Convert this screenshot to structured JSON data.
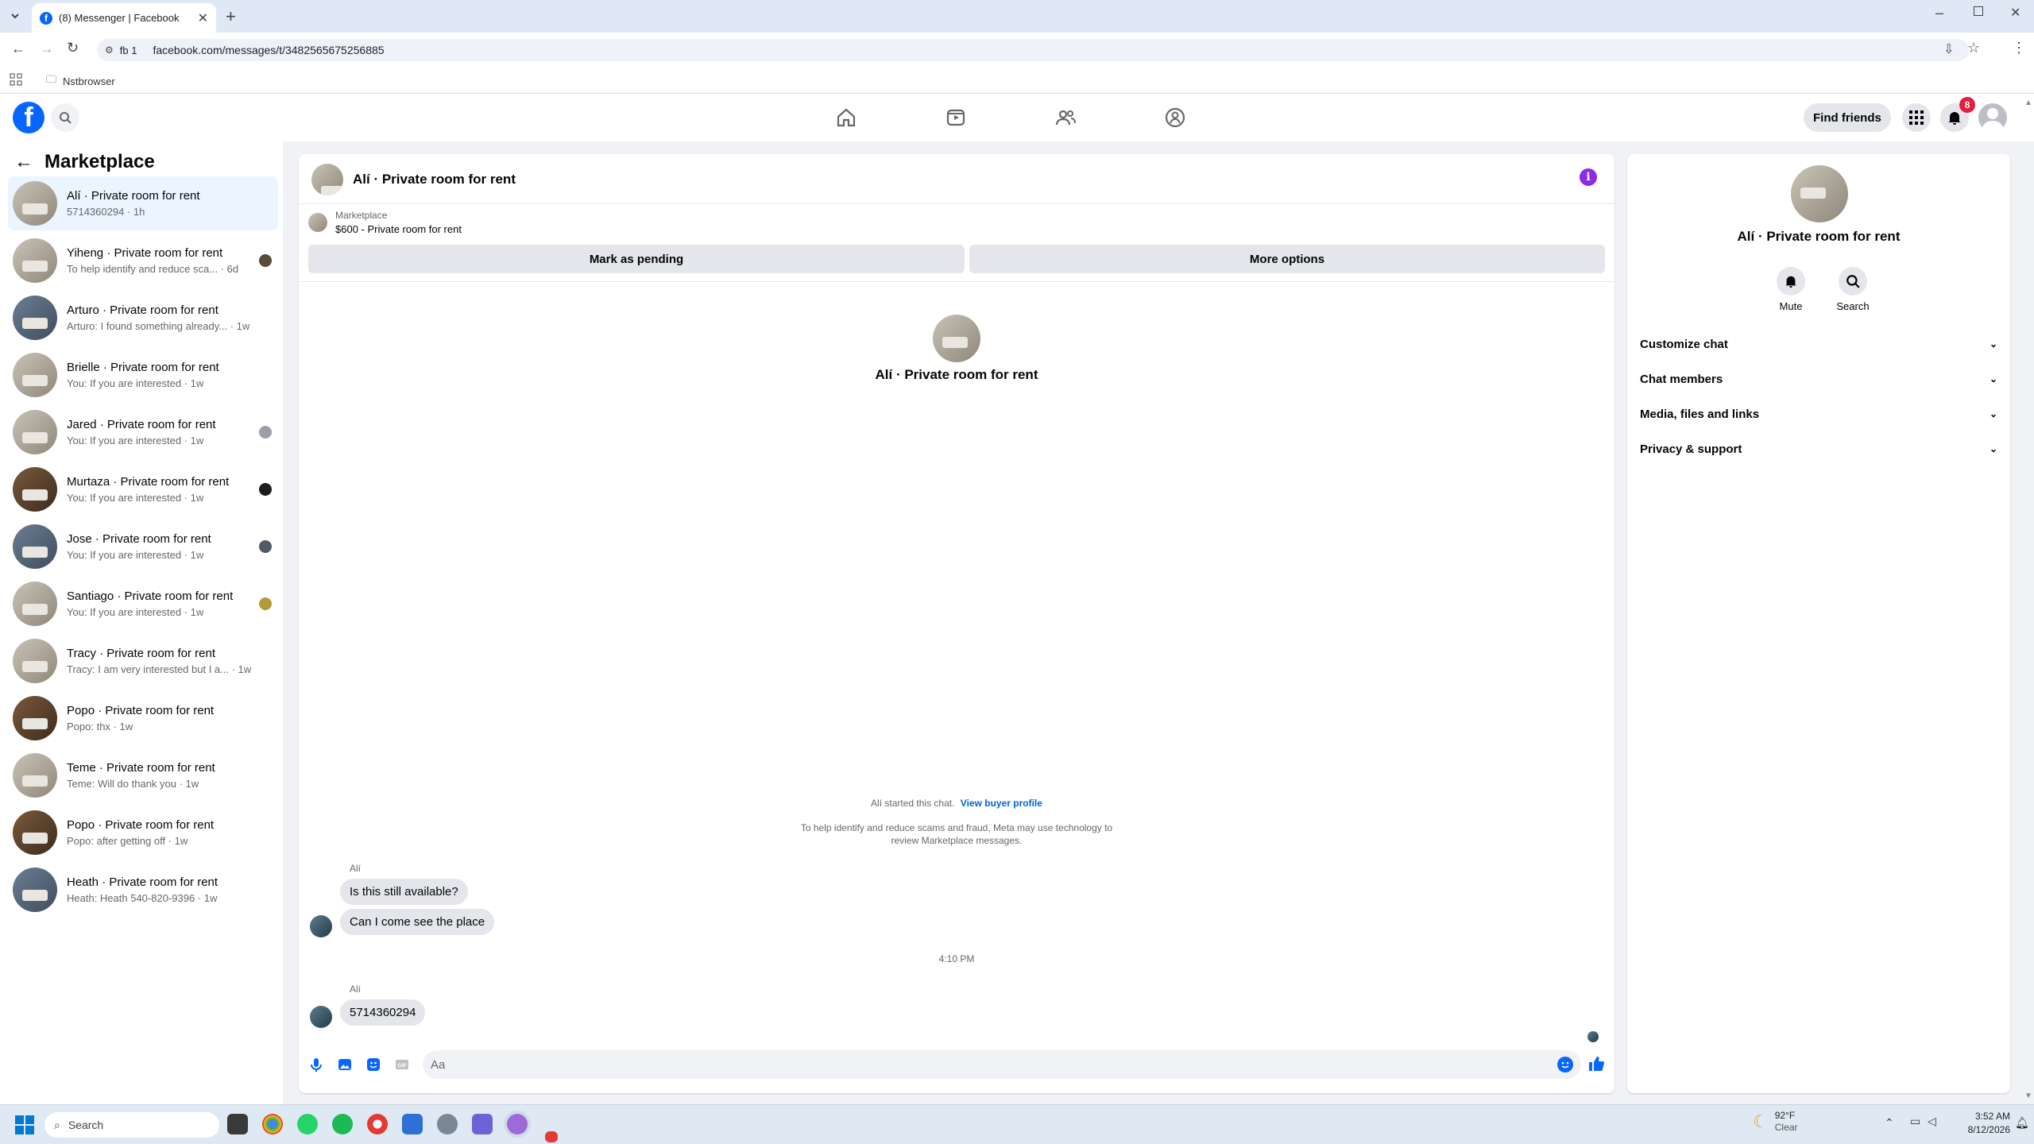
{
  "browser": {
    "tab_title": "(8) Messenger | Facebook",
    "site_chip": "fb 1",
    "url": "facebook.com/messages/t/3482565675256885",
    "bookmark": "Nstbrowser"
  },
  "fb_header": {
    "find_friends": "Find friends",
    "notification_count": "8"
  },
  "left": {
    "title": "Marketplace",
    "conversations": [
      {
        "name": "Alí · Private room for rent",
        "sub": "5714360294 · 1h"
      },
      {
        "name": "Yiheng · Private room for rent",
        "sub": "To help identify and reduce sca... · 6d"
      },
      {
        "name": "Arturo · Private room for rent",
        "sub": "Arturo: I found something already... · 1w"
      },
      {
        "name": "Brielle · Private room for rent",
        "sub": "You: If you are interested · 1w"
      },
      {
        "name": "Jared · Private room for rent",
        "sub": "You: If you are interested · 1w"
      },
      {
        "name": "Murtaza · Private room for rent",
        "sub": "You: If you are interested · 1w"
      },
      {
        "name": "Jose · Private room for rent",
        "sub": "You: If you are interested · 1w"
      },
      {
        "name": "Santiago · Private room for rent",
        "sub": "You: If you are interested · 1w"
      },
      {
        "name": "Tracy · Private room for rent",
        "sub": "Tracy: I am very interested but I a... · 1w"
      },
      {
        "name": "Popo · Private room for rent",
        "sub": "Popo: thx · 1w"
      },
      {
        "name": "Teme · Private room for rent",
        "sub": "Teme: Will do thank you · 1w"
      },
      {
        "name": "Popo · Private room for rent",
        "sub": "Popo: after getting off · 1w"
      },
      {
        "name": "Heath · Private room for rent",
        "sub": "Heath: Heath 540-820-9396 · 1w"
      }
    ]
  },
  "chat": {
    "header_title": "Alí · Private room for rent",
    "listing_source": "Marketplace",
    "listing_title": "$600 - Private room for rent",
    "mark_pending": "Mark as pending",
    "more_options": "More options",
    "intro_title": "Alí · Private room for rent",
    "started_text": "Alí started this chat.",
    "view_buyer_profile": "View buyer profile",
    "notice_line1": "To help identify and reduce scams and fraud, Meta may use technology to",
    "notice_line2": "review Marketplace messages.",
    "sender1": "Alí",
    "msg1": "Is this still available?",
    "msg2": "Can I come see the place",
    "timestamp": "4:10 PM",
    "sender2": "Alí",
    "msg3": "5714360294",
    "composer_placeholder": "Aa"
  },
  "right": {
    "title": "Alí · Private room for rent",
    "mute": "Mute",
    "search": "Search",
    "sections": [
      "Customize chat",
      "Chat members",
      "Media, files and links",
      "Privacy & support"
    ]
  },
  "taskbar": {
    "search_placeholder": "Search",
    "weather_temp": "92°F",
    "weather_desc": "Clear",
    "time": "3:52 AM",
    "date": "8/12/2026"
  },
  "colors": {
    "fb_blue": "#0866ff",
    "link_blue": "#0064d1",
    "info_purple": "#8b2be2",
    "badge_red": "#e41e3f",
    "active_row": "#ebf5ff"
  }
}
